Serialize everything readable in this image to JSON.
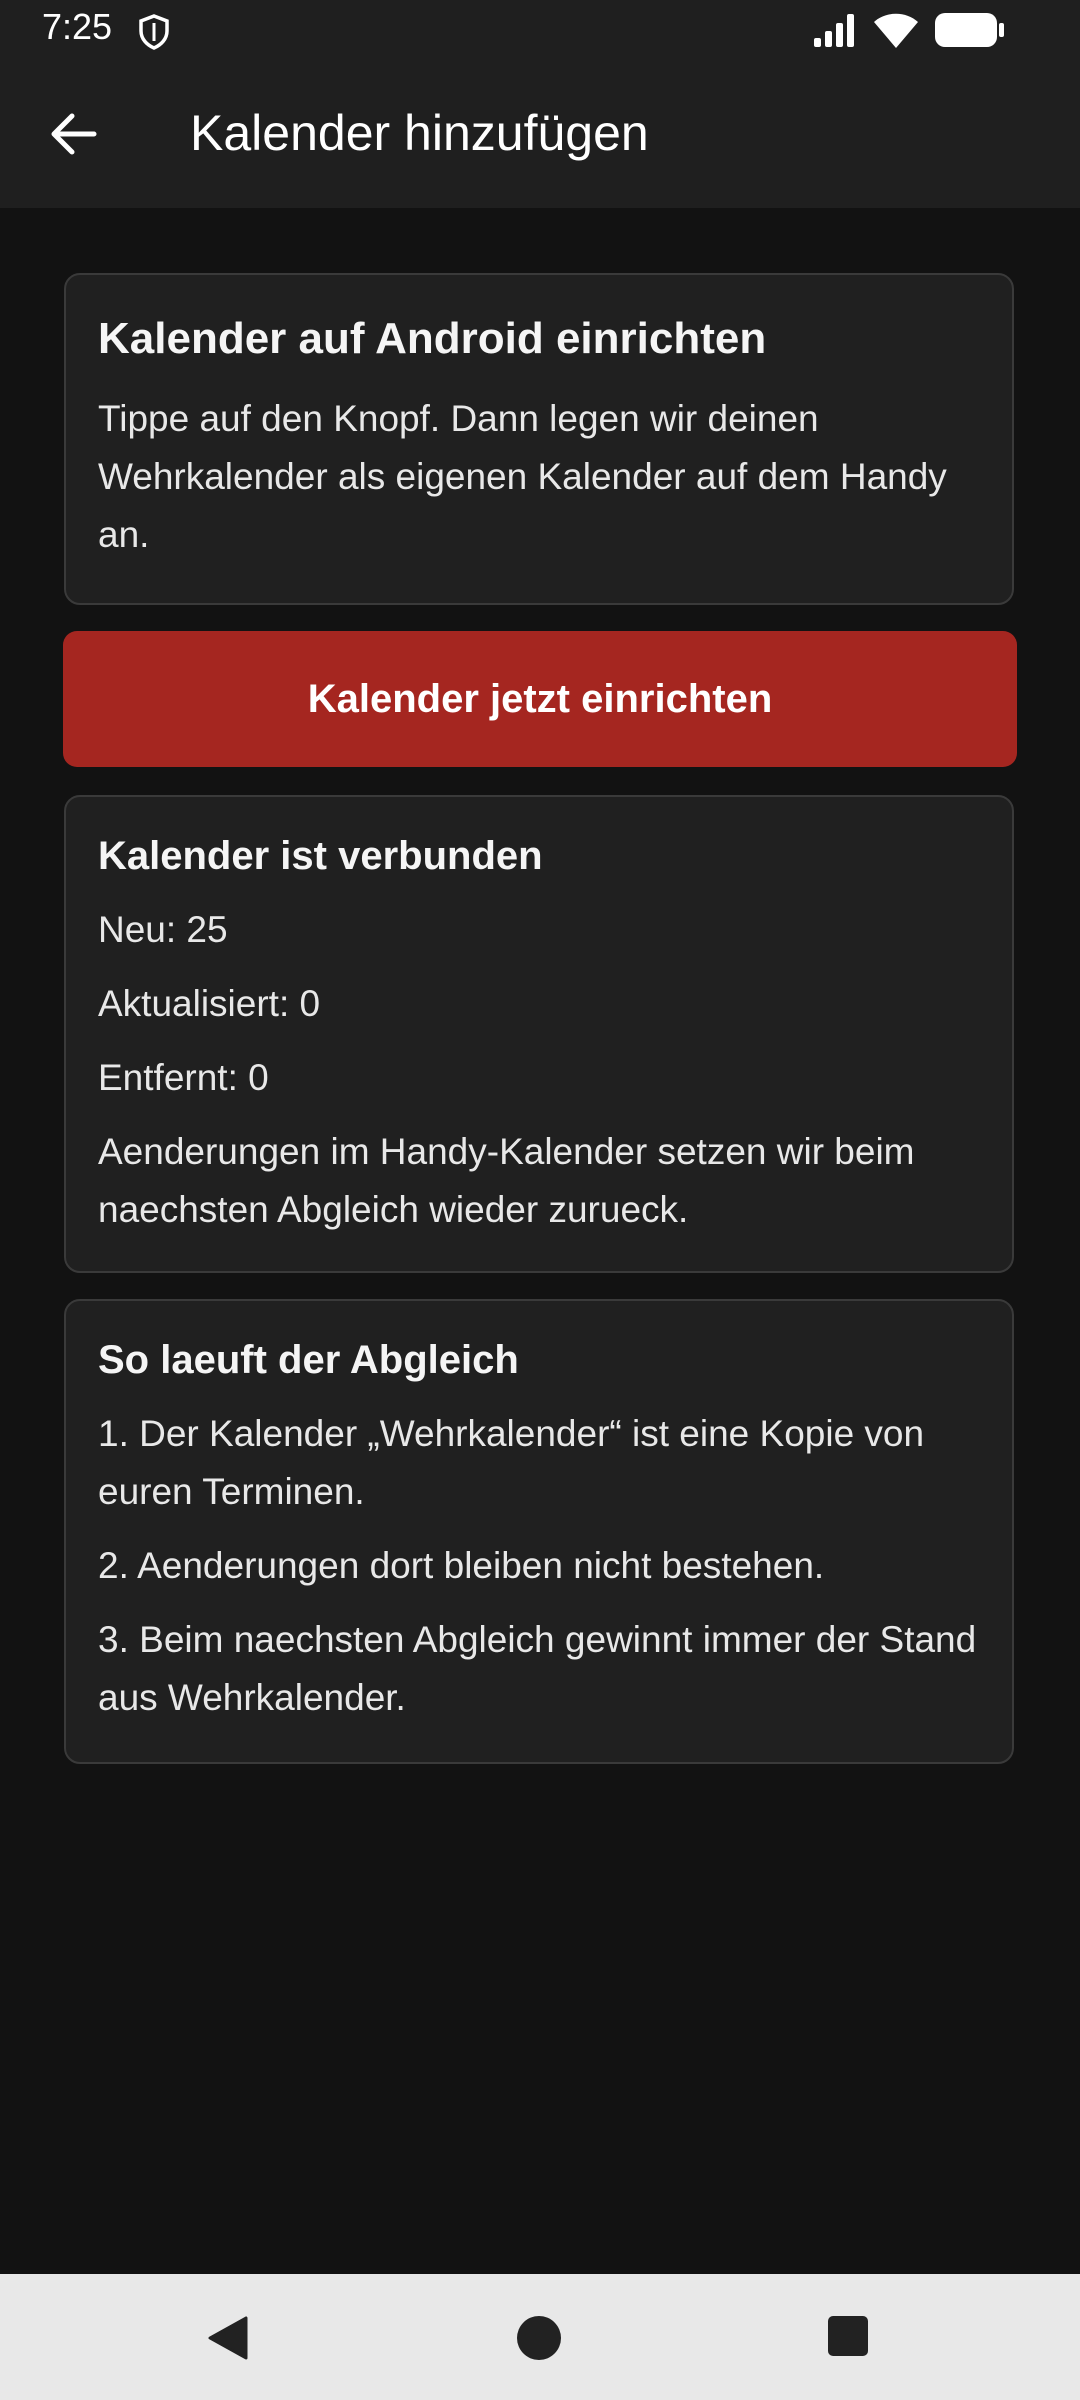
{
  "status_bar": {
    "time": "7:25",
    "icons": [
      "shield-icon",
      "signal-icon",
      "wifi-icon",
      "battery-icon"
    ]
  },
  "app_bar": {
    "title": "Kalender hinzufügen",
    "back_icon": "arrow-left-icon"
  },
  "setup_card": {
    "title": "Kalender auf Android einrichten",
    "text": "Tippe auf den Knopf. Dann legen wir deinen Wehrkalender als eigenen Kalender auf dem Handy an."
  },
  "setup_button": {
    "label": "Kalender jetzt einrichten"
  },
  "status_card": {
    "title": "Kalender ist verbunden",
    "new": "Neu: 25",
    "updated": "Aktualisiert: 0",
    "removed": "Entfernt: 0",
    "note": "Aenderungen im Handy-Kalender setzen wir beim naechsten Abgleich wieder zurueck."
  },
  "sync_card": {
    "title": "So laeuft der Abgleich",
    "steps": [
      "1. Der Kalender „Wehrkalender“ ist eine Kopie von euren Terminen.",
      "2. Aenderungen dort bleiben nicht bestehen.",
      "3. Beim naechsten Abgleich gewinnt immer der Stand aus Wehrkalender."
    ]
  },
  "colors": {
    "background": "#121212",
    "surface": "#202020",
    "accent": "#a52620",
    "nav_bar": "#e8e8e8"
  }
}
